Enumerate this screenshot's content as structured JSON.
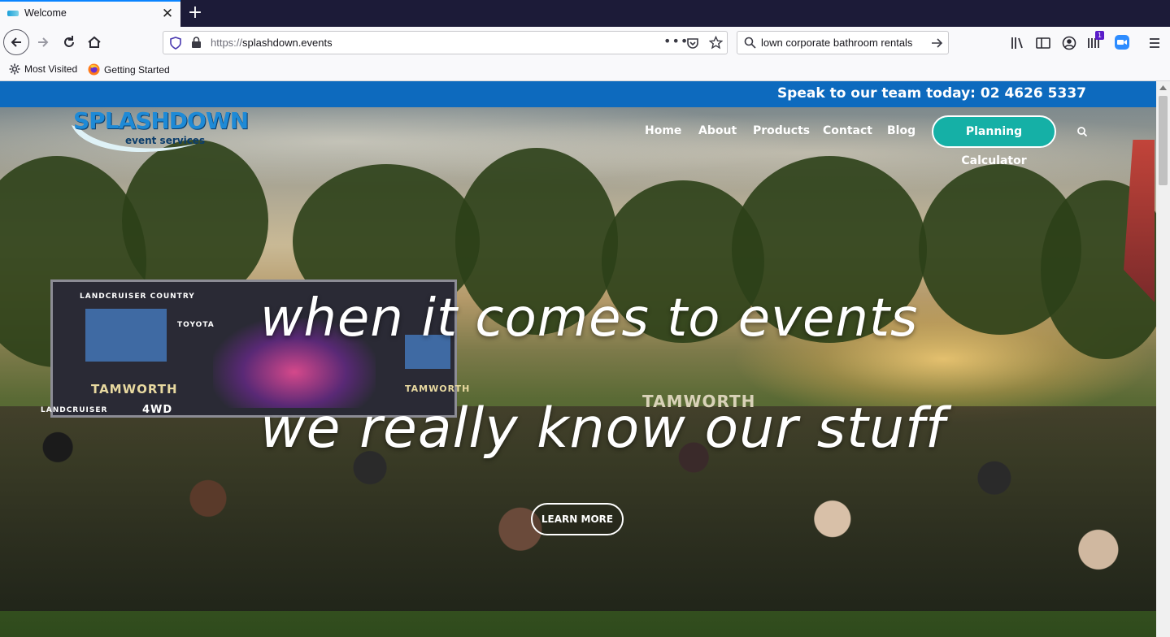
{
  "browser": {
    "tab_title": "Welcome",
    "url_scheme": "https://",
    "url_host": "splashdown.events",
    "search_text": "lown corporate bathroom rentals",
    "bookmarks": [
      {
        "label": "Most Visited"
      },
      {
        "label": "Getting Started"
      }
    ],
    "extension_badge": "1"
  },
  "site": {
    "phone_text": "Speak to our team today: 02 4626 5337",
    "logo_main": "SPLASHDOWN",
    "logo_sub": "event services",
    "menu": [
      "Home",
      "About",
      "Products",
      "Contact",
      "Blog"
    ],
    "cta_label": "Planning Calculator",
    "hero_line1": "when it comes to events",
    "hero_line2": "we really know our stuff",
    "learn_more": "LEARN MORE",
    "banners": [
      "TAMWORTH",
      "TAMWORTH",
      "TAMWORTH",
      "TOYOTA",
      "4WD",
      "LANDCRUISER",
      "LANDCRUISER COUNTRY"
    ]
  },
  "colors": {
    "topstrip": "#0d6abe",
    "cta": "#15b0a6",
    "tabbar": "#1c1b38"
  }
}
